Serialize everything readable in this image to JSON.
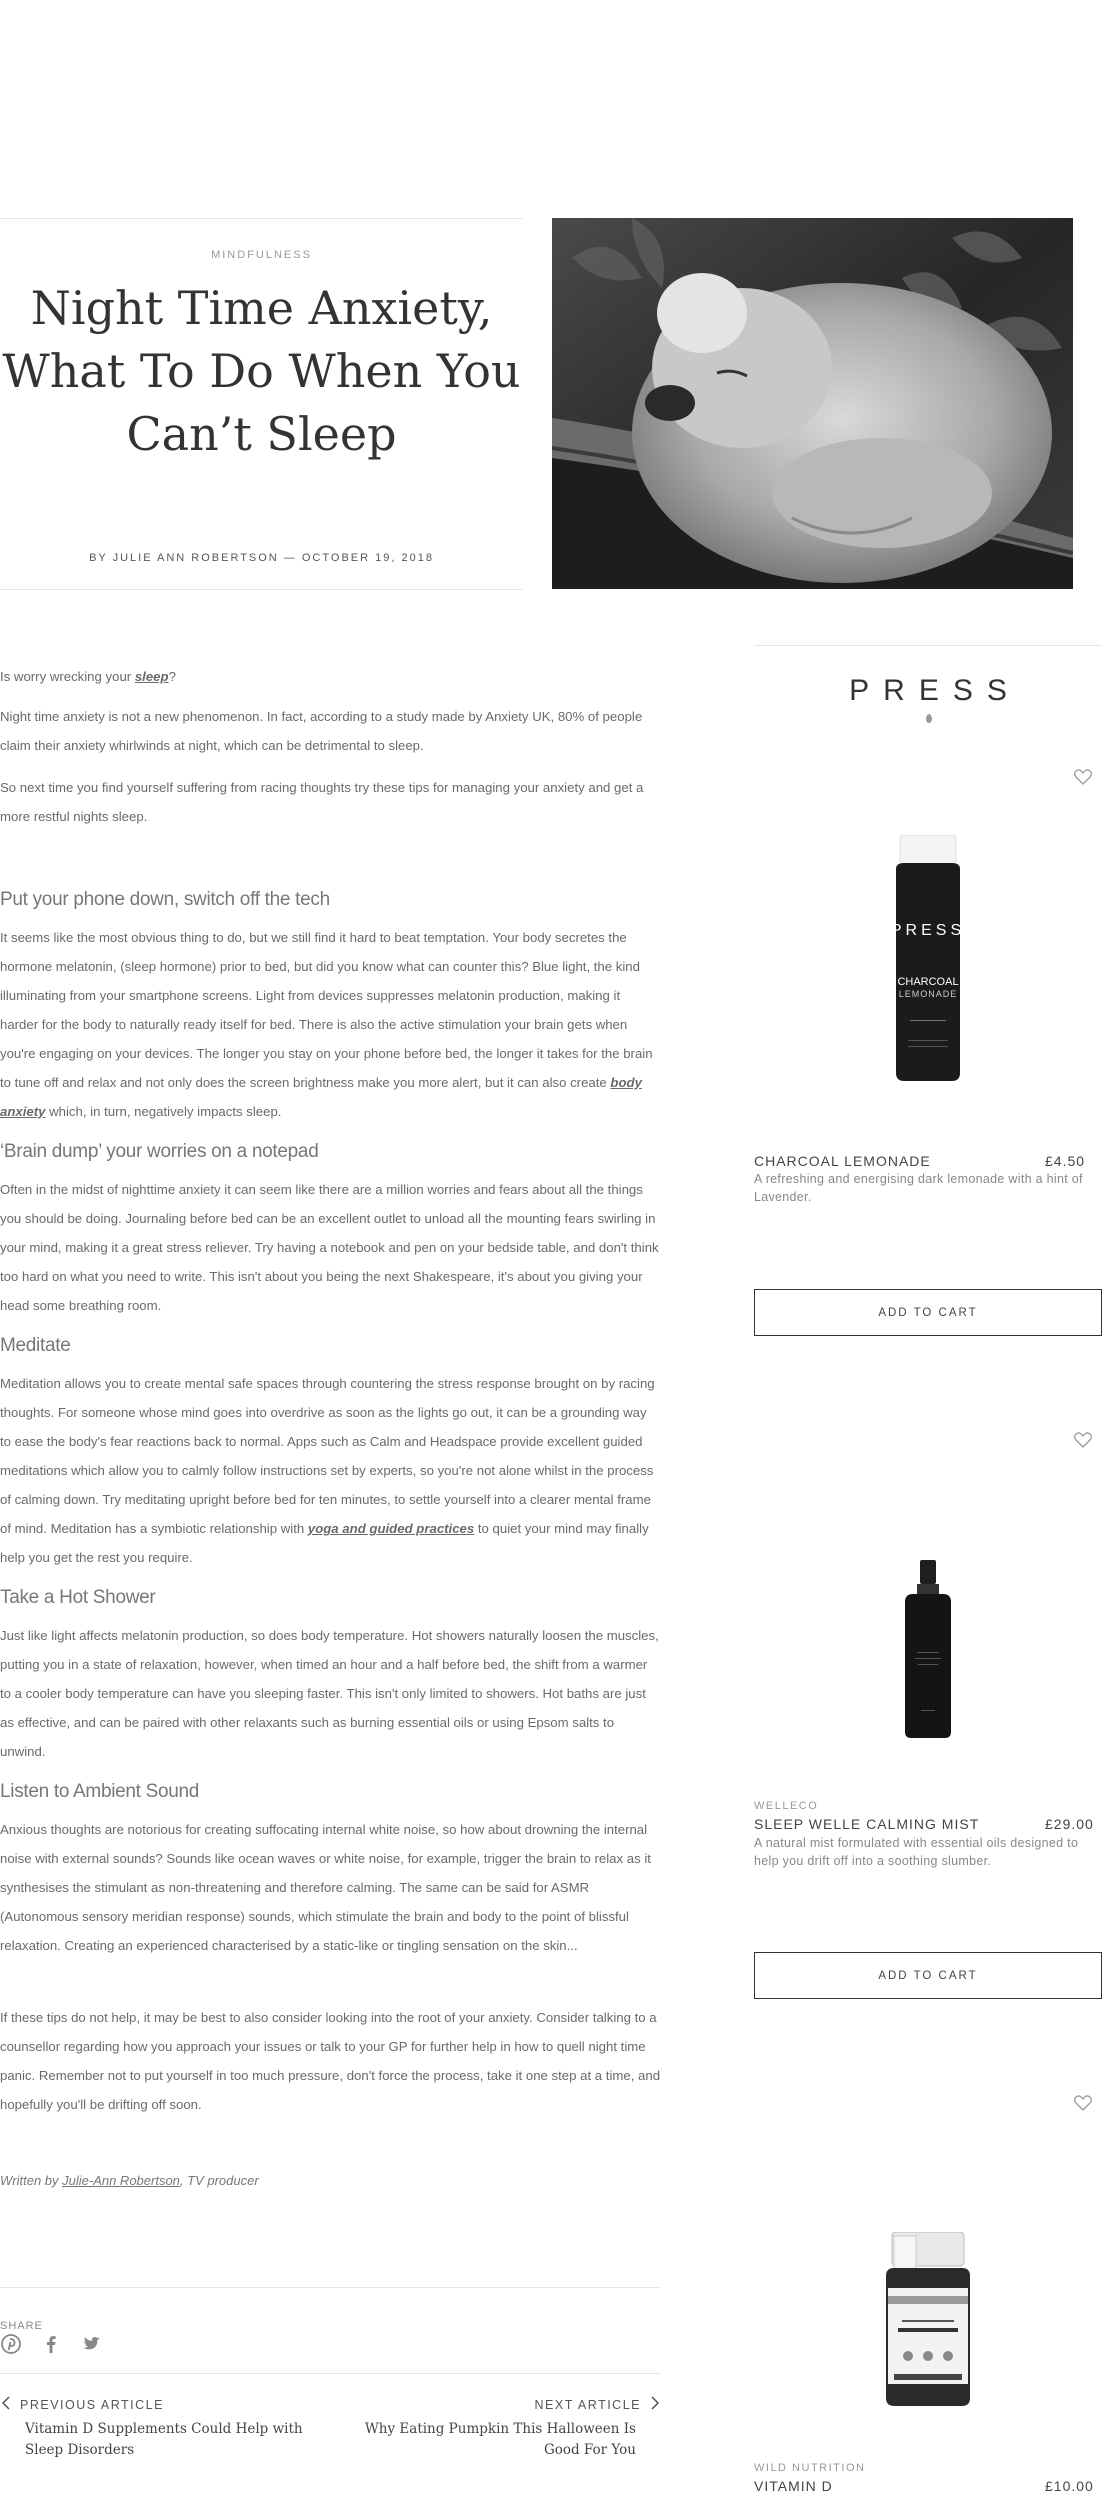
{
  "hero": {
    "category": "MINDFULNESS",
    "title": "Night Time Anxiety, What To Do When You Can’t Sleep",
    "byline": "BY JULIE ANN ROBERTSON — OCTOBER 19, 2018",
    "image_icon": "koala-photo"
  },
  "article": {
    "intro_prefix": "Is worry wrecking your ",
    "intro_link": "sleep",
    "intro_suffix": "?",
    "p1": "Night time anxiety is not a new phenomenon. In fact, according to a study made by Anxiety UK, 80% of people claim their anxiety whirlwinds at night, which can be detrimental to sleep.",
    "p2": "So next time you find yourself suffering from racing thoughts try these tips for managing your anxiety and get a more restful nights sleep.",
    "h1": "Put your phone down, switch off the tech",
    "s1_text": "It seems like the most obvious thing to do, but we still find it hard to beat temptation. Your body secretes the hormone melatonin, (sleep hormone) prior to bed, but did you know what can counter this? Blue light, the kind illuminating from your smartphone screens. Light from devices suppresses melatonin production, making it harder for the body to naturally ready itself for bed. There is also the active stimulation your brain gets when you're engaging on your devices. The longer you stay on your phone before bed, the longer it takes for the brain to tune off and relax and not only does the screen brightness make you more alert, but it can also create ",
    "s1_link": "body anxiety",
    "s1_suffix": " which, in turn, negatively impacts sleep.",
    "h2": "‘Brain dump’ your worries on a notepad",
    "s2": "Often in the midst of nighttime anxiety it can seem like there are a million worries and fears about all the things you should be doing. Journaling before bed can be an excellent outlet to unload all the mounting fears swirling in your mind, making it a great stress reliever. Try having a notebook and pen on your bedside table, and don't think too hard on what you need to write. This isn't about you being the next Shakespeare, it's about you giving your head some breathing room.",
    "h3": "Meditate",
    "s3_text": "Meditation allows you to create mental safe spaces through countering the stress response brought on by racing thoughts. For someone whose mind goes into overdrive as soon as the lights go out, it can be a grounding way to ease the body's fear reactions back to normal. Apps such as Calm and Headspace provide excellent guided meditations which allow you to calmly follow instructions set by experts, so you're not alone whilst in the process of calming down. Try meditating upright before bed for ten minutes, to settle yourself into a clearer mental frame of mind. Meditation has a symbiotic relationship with ",
    "s3_link": "yoga and guided practices",
    "s3_suffix": " to quiet your mind may finally help you get the rest you require.",
    "h4": "Take a Hot Shower",
    "s4": "Just like light affects melatonin production, so does body temperature. Hot showers naturally loosen the muscles, putting you in a state of relaxation, however, when timed an hour and a half before bed, the shift from a warmer to a cooler body temperature can have you sleeping faster. This isn't only limited to showers. Hot baths are just as effective, and can be paired with other relaxants such as burning essential oils or using Epsom salts to unwind.",
    "h5": "Listen to Ambient Sound",
    "s5": "Anxious thoughts are notorious for creating suffocating internal white noise, so how about drowning the internal noise with external sounds? Sounds like ocean waves or white noise, for example, trigger the brain to relax as it synthesises the stimulant as non-threatening and therefore calming. The same can be said for ASMR (Autonomous sensory meridian response) sounds, which stimulate the brain and body to the point of blissful relaxation. Creating an experienced characterised by a static-like or tingling sensation on the skin...",
    "closing": "If these tips do not help, it may be best to also consider looking into the root of your anxiety. Consider talking to a counsellor regarding how you approach your issues or talk to your GP for further help in how to quell night time panic. Remember not to put yourself in too much pressure, don't force the process, take it one step at a time, and hopefully you'll be drifting off soon.",
    "credit_prefix": "Written by ",
    "credit_link": "Julie-Ann Robertson",
    "credit_suffix": ", TV producer"
  },
  "share": {
    "label": "SHARE",
    "icons": [
      "pinterest-icon",
      "facebook-icon",
      "twitter-icon"
    ]
  },
  "nav": {
    "prev_label": "PREVIOUS ARTICLE",
    "prev_title": "Vitamin D Supplements Could Help with Sleep Disorders",
    "next_label": "NEXT ARTICLE",
    "next_title": "Why Eating Pumpkin This Halloween Is Good For You"
  },
  "sidebar": {
    "logo": "PRESS",
    "bottle_logo": "PRESS",
    "bottle_name": "CHARCOAL",
    "bottle_sub": "LEMONADE",
    "bottle_small": "LEMON + LAVENDER\nACTIVATED CHARCOAL",
    "products": [
      {
        "brand": "",
        "name": "CHARCOAL LEMONADE",
        "price": "£4.50",
        "description": "A refreshing and energising dark lemonade with a hint of Lavender.",
        "cta": "ADD TO CART"
      },
      {
        "brand": "WELLECO",
        "name": "SLEEP WELLE CALMING MIST",
        "price": "£29.00",
        "description": "A natural mist formulated with essential oils designed to help you drift off into a soothing slumber.",
        "cta": "ADD TO CART"
      },
      {
        "brand": "WILD NUTRITION",
        "name": "VITAMIN D",
        "price": "£10.00",
        "description": "",
        "cta": ""
      }
    ]
  },
  "colors": {
    "text": "#6a6a6a",
    "heading": "#333333",
    "rule": "#e6e6e6",
    "button_border": "#333333"
  }
}
